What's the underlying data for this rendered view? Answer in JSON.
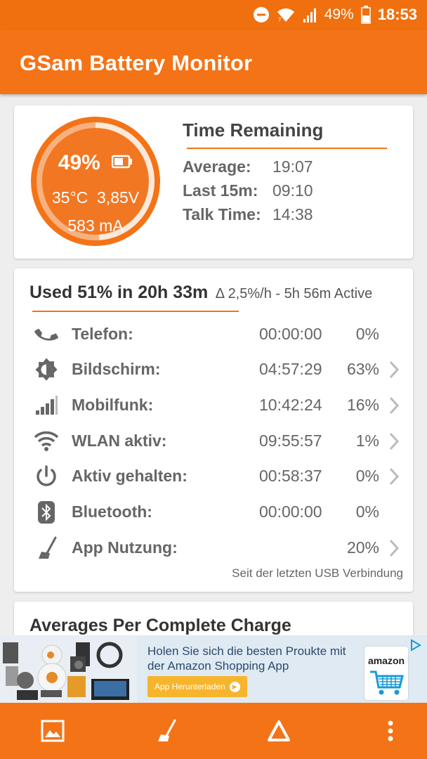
{
  "status_bar": {
    "battery_percent": "49%",
    "time": "18:53",
    "icons": [
      "do-not-disturb-icon",
      "wifi-icon",
      "signal-icon",
      "battery-icon"
    ]
  },
  "app_bar": {
    "title": "GSam Battery Monitor"
  },
  "battery": {
    "percent": "49%",
    "level": 0.49,
    "temperature": "35°C",
    "voltage": "3,85V",
    "current": "583 mA",
    "gauge_color": "#f47317"
  },
  "time_remaining": {
    "title": "Time Remaining",
    "rows": [
      {
        "label": "Average:",
        "value": "19:07"
      },
      {
        "label": "Last 15m:",
        "value": "09:10"
      },
      {
        "label": "Talk Time:",
        "value": "14:38"
      }
    ]
  },
  "usage": {
    "title": "Used 51% in 20h 33m",
    "subtitle": "Δ 2,5%/h - 5h 56m Active",
    "rows": [
      {
        "icon": "phone-icon",
        "label": "Telefon:",
        "time": "00:00:00",
        "percent": "0%",
        "chevron": false
      },
      {
        "icon": "screen-brightness-icon",
        "label": "Bildschirm:",
        "time": "04:57:29",
        "percent": "63%",
        "chevron": true
      },
      {
        "icon": "cell-signal-icon",
        "label": "Mobilfunk:",
        "time": "10:42:24",
        "percent": "16%",
        "chevron": true
      },
      {
        "icon": "wifi-icon",
        "label": "WLAN aktiv:",
        "time": "09:55:57",
        "percent": "1%",
        "chevron": true
      },
      {
        "icon": "power-icon",
        "label": "Aktiv gehalten:",
        "time": "00:58:37",
        "percent": "0%",
        "chevron": true
      },
      {
        "icon": "bluetooth-icon",
        "label": "Bluetooth:",
        "time": "00:00:00",
        "percent": "0%",
        "chevron": false
      },
      {
        "icon": "broom-icon",
        "label": "App Nutzung:",
        "time": "",
        "percent": "20%",
        "chevron": true
      }
    ],
    "footnote": "Seit der letzten USB Verbindung"
  },
  "averages": {
    "title": "Averages Per Complete Charge"
  },
  "ad": {
    "text": "Holen Sie sich die besten Proukte mit der Amazon Shopping App",
    "button": "App Herunterladen",
    "logo": "amazon"
  },
  "bottom_nav": [
    "image-icon",
    "broom-icon",
    "delta-icon",
    "more-vert-icon"
  ],
  "colors": {
    "accent": "#f47317",
    "status_bar": "#f0700f"
  }
}
